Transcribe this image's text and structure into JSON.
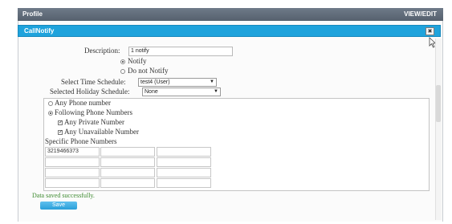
{
  "outer_window": {
    "title": "Profile",
    "view_edit_label": "VIEW/EDIT"
  },
  "dialog": {
    "title": "CallNotify",
    "close_glyph": "✖"
  },
  "form": {
    "description_label": "Description:",
    "description_value": "1 notify",
    "notify_options": [
      {
        "label": "Notify",
        "selected": true
      },
      {
        "label": "Do not Notify",
        "selected": false
      }
    ],
    "time_schedule_label": "Select Time Schedule:",
    "time_schedule_value": "test4 (User)",
    "holiday_schedule_label": "Selected Holiday Schedule:",
    "holiday_schedule_value": "None",
    "phone_options": [
      {
        "label": "Any Phone number",
        "selected": false
      },
      {
        "label": "Following Phone Numbers",
        "selected": true
      }
    ],
    "checkboxes": [
      {
        "label": "Any Private Number",
        "checked": true
      },
      {
        "label": "Any Unavailable Number",
        "checked": true
      }
    ],
    "specific_label": "Specific Phone Numbers",
    "phone_table": [
      [
        "3219466373",
        "",
        ""
      ],
      [
        "",
        "",
        ""
      ],
      [
        "",
        "",
        ""
      ],
      [
        "",
        "",
        ""
      ]
    ]
  },
  "status": {
    "message": "Data saved successfully."
  },
  "save_button": {
    "label": "Save"
  },
  "icons": {
    "close": "close-icon",
    "cursor": "mouse-pointer-icon",
    "dropdown": "chevron-down-icon"
  }
}
